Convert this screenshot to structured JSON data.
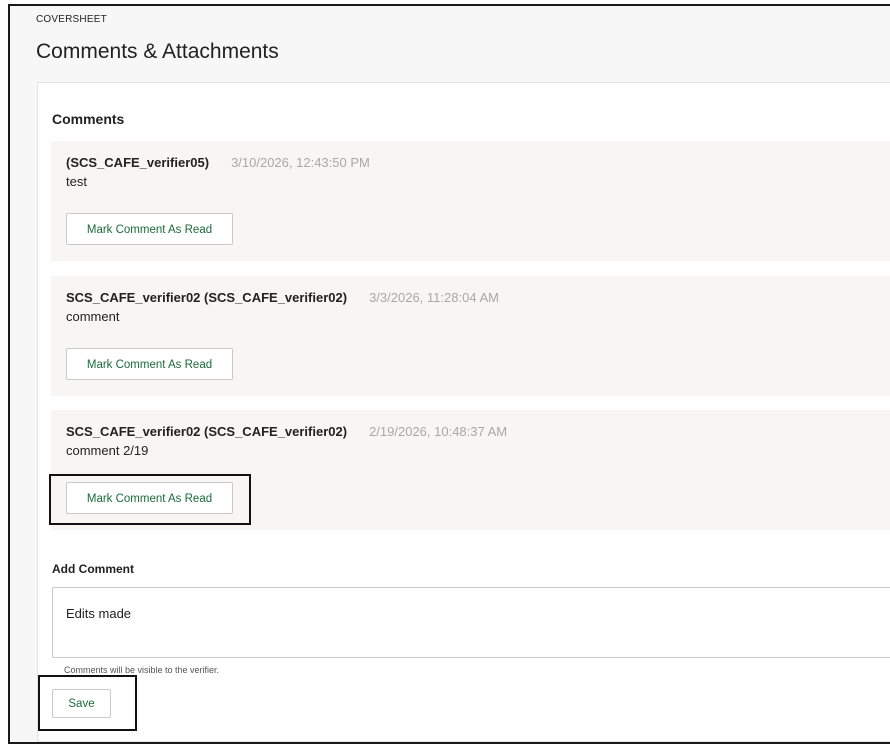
{
  "header": {
    "eyebrow": "COVERSHEET",
    "title": "Comments & Attachments"
  },
  "comments_section": {
    "heading": "Comments",
    "items": [
      {
        "author": "(SCS_CAFE_verifier05)",
        "timestamp": "3/10/2026, 12:43:50 PM",
        "text": "test",
        "action_label": "Mark Comment As Read"
      },
      {
        "author": "SCS_CAFE_verifier02 (SCS_CAFE_verifier02)",
        "timestamp": "3/3/2026, 11:28:04 AM",
        "text": "comment",
        "action_label": "Mark Comment As Read"
      },
      {
        "author": "SCS_CAFE_verifier02 (SCS_CAFE_verifier02)",
        "timestamp": "2/19/2026, 10:48:37 AM",
        "text": "comment 2/19",
        "action_label": "Mark Comment As Read"
      }
    ]
  },
  "add_comment": {
    "heading": "Add Comment",
    "value": "Edits made",
    "helper": "Comments will be visible to the verifier.",
    "save_label": "Save"
  },
  "colors": {
    "accent_text": "#1c6b3a",
    "card_background": "#f7f6f3",
    "timestamp": "#a8a8a8"
  }
}
